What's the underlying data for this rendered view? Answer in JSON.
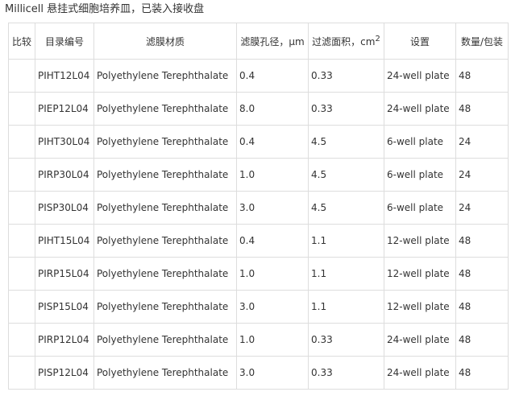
{
  "caption": "Millicell 悬挂式细胞培养皿，已装入接收盘",
  "table": {
    "headers": {
      "compare": "比较",
      "catalog": "目录编号",
      "material": "滤膜材质",
      "pore": "滤膜孔径，μm",
      "area": "过滤面积，cm",
      "area_exponent": "2",
      "setting": "设置",
      "quantity": "数量/包装"
    },
    "rows": [
      {
        "catalog": "PIHT12L04",
        "material": "Polyethylene Terephthalate",
        "pore": "0.4",
        "area": "0.33",
        "setting": "24-well plate",
        "quantity": "48"
      },
      {
        "catalog": "PIEP12L04",
        "material": "Polyethylene Terephthalate",
        "pore": "8.0",
        "area": "0.33",
        "setting": "24-well plate",
        "quantity": "48"
      },
      {
        "catalog": "PIHT30L04",
        "material": "Polyethylene Terephthalate",
        "pore": "0.4",
        "area": "4.5",
        "setting": "6-well plate",
        "quantity": "24"
      },
      {
        "catalog": "PIRP30L04",
        "material": "Polyethylene Terephthalate",
        "pore": "1.0",
        "area": "4.5",
        "setting": "6-well plate",
        "quantity": "24"
      },
      {
        "catalog": "PISP30L04",
        "material": "Polyethylene Terephthalate",
        "pore": "3.0",
        "area": "4.5",
        "setting": "6-well plate",
        "quantity": "24"
      },
      {
        "catalog": "PIHT15L04",
        "material": "Polyethylene Terephthalate",
        "pore": "0.4",
        "area": "1.1",
        "setting": "12-well plate",
        "quantity": "48"
      },
      {
        "catalog": "PIRP15L04",
        "material": "Polyethylene Terephthalate",
        "pore": "1.0",
        "area": "1.1",
        "setting": "12-well plate",
        "quantity": "48"
      },
      {
        "catalog": "PISP15L04",
        "material": "Polyethylene Terephthalate",
        "pore": "3.0",
        "area": "1.1",
        "setting": "12-well plate",
        "quantity": "48"
      },
      {
        "catalog": "PIRP12L04",
        "material": "Polyethylene Terephthalate",
        "pore": "1.0",
        "area": "0.33",
        "setting": "24-well plate",
        "quantity": "48"
      },
      {
        "catalog": "PISP12L04",
        "material": "Polyethylene Terephthalate",
        "pore": "3.0",
        "area": "0.33",
        "setting": "24-well plate",
        "quantity": "48"
      }
    ]
  }
}
